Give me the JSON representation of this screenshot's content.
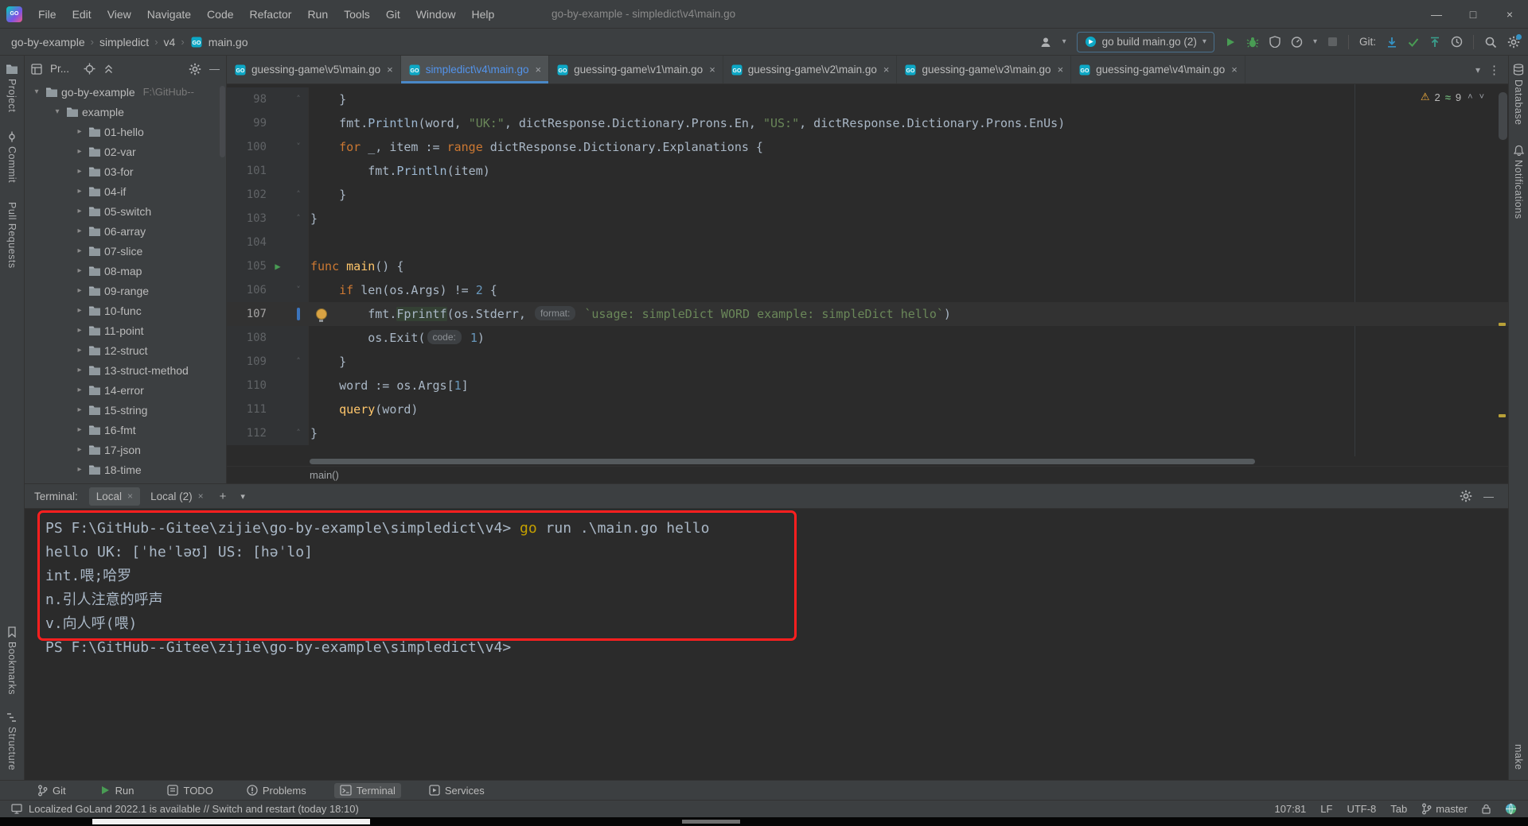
{
  "window": {
    "logo": "GO",
    "title": "go-by-example - simpledict\\v4\\main.go",
    "menu": [
      "File",
      "Edit",
      "View",
      "Navigate",
      "Code",
      "Refactor",
      "Run",
      "Tools",
      "Git",
      "Window",
      "Help"
    ],
    "controls": {
      "minimize": "—",
      "maximize": "□",
      "close": "×"
    }
  },
  "icons": {
    "warning": "⚠",
    "typo": "≈",
    "chevron_up": "˄",
    "chevron_down": "˅",
    "dropdown": "▾",
    "expand": "▸",
    "collapse": "▾",
    "close": "×",
    "more": "⋮",
    "plus": "+",
    "minus": "—",
    "run": "▶",
    "fold_up": "˄",
    "fold_down": "˅"
  },
  "navbar": {
    "breadcrumbs": [
      "go-by-example",
      "simpledict",
      "v4",
      "main.go"
    ],
    "separator": "›",
    "run_config": "go build main.go (2)",
    "git_label": "Git:"
  },
  "strips": {
    "left_top": [
      {
        "label": "Project",
        "icon": "folder"
      },
      {
        "label": "Commit",
        "icon": "commit"
      },
      {
        "label": "Pull Requests",
        "icon": ""
      }
    ],
    "left_bottom": [
      {
        "label": "Bookmarks",
        "icon": "bookmark"
      },
      {
        "label": "Structure",
        "icon": "structure"
      }
    ],
    "right_top": [
      {
        "label": "Database",
        "icon": "database"
      },
      {
        "label": "Notifications",
        "icon": "bell"
      }
    ],
    "right_bottom": [
      {
        "label": "make",
        "icon": ""
      }
    ]
  },
  "project": {
    "tab_label": "Pr...",
    "root_name": "go-by-example",
    "root_path": "F:\\GitHub--",
    "subfolder": "example",
    "folders": [
      "01-hello",
      "02-var",
      "03-for",
      "04-if",
      "05-switch",
      "06-array",
      "07-slice",
      "08-map",
      "09-range",
      "10-func",
      "11-point",
      "12-struct",
      "13-struct-method",
      "14-error",
      "15-string",
      "16-fmt",
      "17-json",
      "18-time"
    ]
  },
  "tabs": [
    {
      "label": "guessing-game\\v5\\main.go",
      "active": false
    },
    {
      "label": "simpledict\\v4\\main.go",
      "active": true
    },
    {
      "label": "guessing-game\\v1\\main.go",
      "active": false
    },
    {
      "label": "guessing-game\\v2\\main.go",
      "active": false
    },
    {
      "label": "guessing-game\\v3\\main.go",
      "active": false
    },
    {
      "label": "guessing-game\\v4\\main.go",
      "active": false
    }
  ],
  "editor": {
    "inspections": {
      "warning_count": "2",
      "typo_count": "9"
    },
    "breadcrumb": "main()",
    "lines": [
      {
        "num": "98",
        "fold": "up",
        "segments": [
          [
            "p",
            "    }"
          ]
        ]
      },
      {
        "num": "99",
        "fold": "",
        "segments": [
          [
            "p",
            "    fmt."
          ],
          [
            "c",
            "Println"
          ],
          [
            "p",
            "(word, "
          ],
          [
            "s",
            "\"UK:\""
          ],
          [
            "p",
            ", dictResponse.Dictionary.Prons.En, "
          ],
          [
            "s",
            "\"US:\""
          ],
          [
            "p",
            ", dictResponse.Dictionary.Prons.EnUs)"
          ]
        ]
      },
      {
        "num": "100",
        "fold": "down",
        "segments": [
          [
            "p",
            "    "
          ],
          [
            "k",
            "for"
          ],
          [
            "p",
            " _, item := "
          ],
          [
            "k",
            "range"
          ],
          [
            "p",
            " dictResponse.Dictionary.Explanations {"
          ]
        ]
      },
      {
        "num": "101",
        "fold": "",
        "segments": [
          [
            "p",
            "        fmt."
          ],
          [
            "c",
            "Println"
          ],
          [
            "p",
            "(item)"
          ]
        ]
      },
      {
        "num": "102",
        "fold": "up",
        "segments": [
          [
            "p",
            "    }"
          ]
        ]
      },
      {
        "num": "103",
        "fold": "up",
        "segments": [
          [
            "p",
            "}"
          ]
        ]
      },
      {
        "num": "104",
        "fold": "",
        "segments": []
      },
      {
        "num": "105",
        "fold": "",
        "run": true,
        "segments": [
          [
            "k",
            "func"
          ],
          [
            "p",
            " "
          ],
          [
            "f",
            "main"
          ],
          [
            "p",
            "() {"
          ]
        ]
      },
      {
        "num": "106",
        "fold": "down",
        "segments": [
          [
            "p",
            "    "
          ],
          [
            "k",
            "if"
          ],
          [
            "p",
            " len(os.Args) != "
          ],
          [
            "n",
            "2"
          ],
          [
            "p",
            " {"
          ]
        ]
      },
      {
        "num": "107",
        "fold": "",
        "current": true,
        "bulb": true,
        "caret": true,
        "segments": [
          [
            "p",
            "        fmt."
          ],
          [
            "h",
            "Fprintf"
          ],
          [
            "p",
            "(os.Stderr, "
          ],
          [
            "i",
            "format:"
          ],
          [
            "p",
            " "
          ],
          [
            "s",
            "`usage: simpleDict WORD example: simpleDict hello`"
          ],
          [
            "p",
            ")"
          ]
        ]
      },
      {
        "num": "108",
        "fold": "",
        "segments": [
          [
            "p",
            "        os.Exit("
          ],
          [
            "i",
            "code:"
          ],
          [
            "p",
            " "
          ],
          [
            "n",
            "1"
          ],
          [
            "p",
            ")"
          ]
        ]
      },
      {
        "num": "109",
        "fold": "up",
        "segments": [
          [
            "p",
            "    }"
          ]
        ]
      },
      {
        "num": "110",
        "fold": "",
        "segments": [
          [
            "p",
            "    word := os.Args["
          ],
          [
            "n",
            "1"
          ],
          [
            "p",
            "]"
          ]
        ]
      },
      {
        "num": "111",
        "fold": "",
        "segments": [
          [
            "p",
            "    "
          ],
          [
            "f",
            "query"
          ],
          [
            "p",
            "(word)"
          ]
        ]
      },
      {
        "num": "112",
        "fold": "up",
        "segments": [
          [
            "p",
            "}"
          ]
        ]
      }
    ]
  },
  "terminal": {
    "label": "Terminal:",
    "tabs": [
      {
        "label": "Local",
        "active": true
      },
      {
        "label": "Local (2)",
        "active": false
      }
    ],
    "lines": [
      [
        [
          "p",
          "PS F:\\GitHub--Gitee\\zijie\\go-by-example\\simpledict\\v4> "
        ],
        [
          "cmd",
          "go"
        ],
        [
          "p",
          " run .\\main.go hello"
        ]
      ],
      [
        [
          "p",
          "hello UK: [ˈheˈləʊ] US: [həˈlo]"
        ]
      ],
      [
        [
          "p",
          "int.喂;哈罗"
        ]
      ],
      [
        [
          "p",
          "n.引人注意的呼声"
        ]
      ],
      [
        [
          "p",
          "v.向人呼(喂)"
        ]
      ],
      [
        [
          "p",
          "PS F:\\GitHub--Gitee\\zijie\\go-by-example\\simpledict\\v4>"
        ]
      ]
    ]
  },
  "toolbar_bottom": [
    {
      "label": "Git",
      "icon": "branch",
      "active": false
    },
    {
      "label": "Run",
      "icon": "play",
      "active": false
    },
    {
      "label": "TODO",
      "icon": "todo",
      "active": false
    },
    {
      "label": "Problems",
      "icon": "problems",
      "active": false
    },
    {
      "label": "Terminal",
      "icon": "terminal",
      "active": true
    },
    {
      "label": "Services",
      "icon": "services",
      "active": false
    }
  ],
  "statusbar": {
    "message": "Localized GoLand 2022.1 is available // Switch and restart (today 18:10)",
    "caret_position": "107:81",
    "line_separator": "LF",
    "encoding": "UTF-8",
    "indent": "Tab",
    "branch": "master"
  },
  "colors": {
    "accent_blue": "#4A88C7",
    "warning_yellow": "#F4AF3D",
    "run_green": "#499C54",
    "annotation_red": "#FF1F1F"
  }
}
